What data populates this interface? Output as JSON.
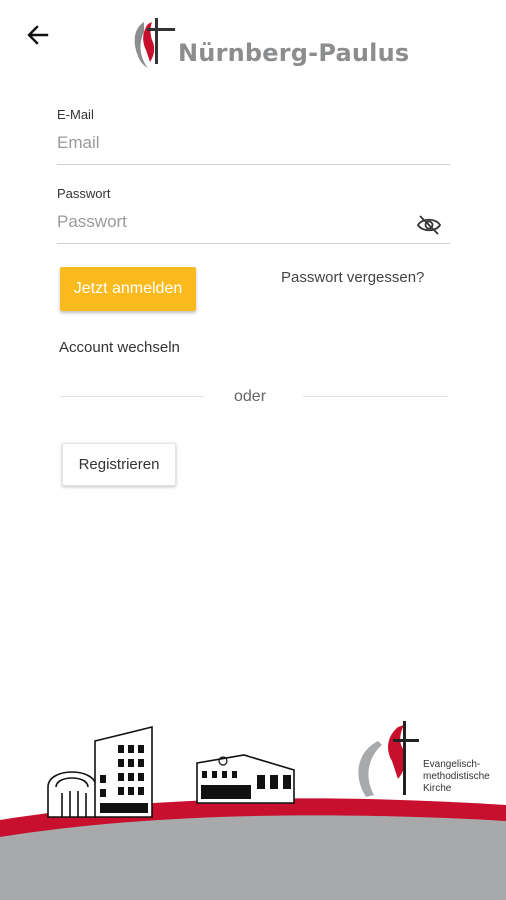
{
  "header": {
    "back_icon": "arrow-left-icon",
    "app_name": "Nürnberg-Paulus",
    "logo_icon": "cross-flame-icon"
  },
  "form": {
    "email": {
      "label": "E-Mail",
      "placeholder": "Email",
      "value": ""
    },
    "password": {
      "label": "Passwort",
      "placeholder": "Passwort",
      "value": "",
      "toggle_icon": "eye-off-icon"
    },
    "login_button": "Jetzt anmelden",
    "forgot_link": "Passwort vergessen?",
    "switch_account": "Account wechseln",
    "separator": "oder",
    "register_button": "Registrieren"
  },
  "footer": {
    "church_name_lines": [
      "Evangelisch-",
      "methodistische",
      "Kirche"
    ]
  },
  "colors": {
    "accent": "#fbbb1f",
    "brand_red": "#c8102e",
    "brand_gray": "#8b8d8f"
  }
}
